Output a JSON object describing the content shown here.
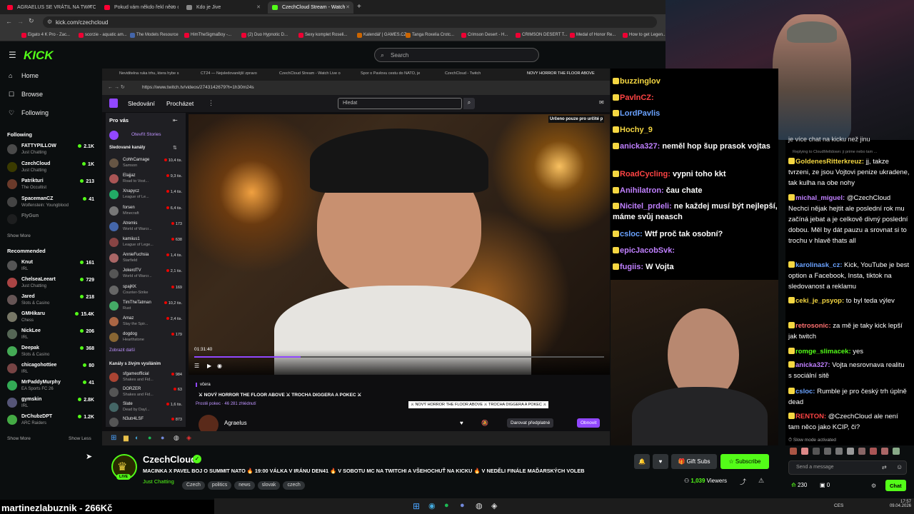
{
  "browser": {
    "tabs": [
      {
        "label": "AGRAELUS SE VRÁTIL NA TWITCH",
        "color": "#ff0033",
        "active": false
      },
      {
        "label": "Pokud vám někdo řekl něco o",
        "color": "#ff0033",
        "active": false
      },
      {
        "label": "Kdo je Jive",
        "color": "#888888",
        "active": false
      },
      {
        "label": "CzechCloud Stream - Watch",
        "color": "#53fc18",
        "active": true
      }
    ],
    "url": "kick.com/czechcloud",
    "bookmarks": [
      {
        "label": "Eigato 4 K Pro - Zac...",
        "color": "#e03"
      },
      {
        "label": "scorzie - aquatic am...",
        "color": "#e03"
      },
      {
        "label": "The Models Resource",
        "color": "#46a"
      },
      {
        "label": "HimTheSigmaBoy -...",
        "color": "#e03"
      },
      {
        "label": "(2) Duo Hypnotic D...",
        "color": "#e03"
      },
      {
        "label": "Sexy komplet Roseli...",
        "color": "#e03"
      },
      {
        "label": "Kalendář | GAMES.CZ",
        "color": "#c60"
      },
      {
        "label": "Tanga Roxelia Crotc...",
        "color": "#c60"
      },
      {
        "label": "Crimson Desert - H...",
        "color": "#e03"
      },
      {
        "label": "CRIMSON DESERT T...",
        "color": "#e03"
      },
      {
        "label": "Medal of Honor Re...",
        "color": "#e03"
      },
      {
        "label": "How to get Legen...",
        "color": "#e03"
      }
    ]
  },
  "kick": {
    "logo": "KICK",
    "search_placeholder": "Search",
    "nav": [
      {
        "icon": "⌂",
        "label": "Home"
      },
      {
        "icon": "☐",
        "label": "Browse"
      },
      {
        "icon": "♡",
        "label": "Following"
      }
    ],
    "following_title": "Following",
    "following": [
      {
        "name": "FATTYPILLOW",
        "category": "Just Chatting",
        "viewers": "2.1K",
        "color": "#4a4a4a"
      },
      {
        "name": "CzechCloud",
        "category": "Just Chatting",
        "viewers": "1K",
        "color": "#3a3a00"
      },
      {
        "name": "Patrikturi",
        "category": "The Occultist",
        "viewers": "213",
        "color": "#6a3a2a"
      },
      {
        "name": "SpacemanCZ",
        "category": "Wolfenstein: Youngblood",
        "viewers": "41",
        "color": "#444"
      },
      {
        "name": "FlyGun",
        "category": "",
        "viewers": "",
        "color": "#333"
      }
    ],
    "show_more": "Show More",
    "recommended_title": "Recommended",
    "recommended": [
      {
        "name": "Knut",
        "category": "IRL",
        "viewers": "161",
        "color": "#555"
      },
      {
        "name": "ChelseaLeeart",
        "category": "Just Chatting",
        "viewers": "729",
        "color": "#a44"
      },
      {
        "name": "Jared",
        "category": "Slots & Casino",
        "viewers": "218",
        "color": "#655"
      },
      {
        "name": "GMHikaru",
        "category": "Chess",
        "viewers": "15.4K",
        "color": "#776"
      },
      {
        "name": "NickLee",
        "category": "IRL",
        "viewers": "206",
        "color": "#565"
      },
      {
        "name": "Deepak",
        "category": "Slots & Casino",
        "viewers": "368",
        "color": "#4a5"
      },
      {
        "name": "chicagohottiee",
        "category": "IRL",
        "viewers": "80",
        "color": "#744"
      },
      {
        "name": "MrPaddyMurphy",
        "category": "EA Sports FC 26",
        "viewers": "41",
        "color": "#3a5"
      },
      {
        "name": "gymskin",
        "category": "IRL",
        "viewers": "2.8K",
        "color": "#557"
      },
      {
        "name": "DrChubzDPT",
        "category": "ARC Raiders",
        "viewers": "1.2K",
        "color": "#4a4"
      }
    ],
    "show_more_2": "Show More",
    "show_less": "Show Less"
  },
  "inner_browser": {
    "tabs": [
      "Neviditelna ruka trhu, ktera hybe s",
      "CT24 — Nejsledovanější zpravo",
      "CzechCloud Stream - Watch Live o",
      "Spor o Pavlovu cestu do NATO, je",
      "CzechCloud - Twitch",
      "NOVÝ HORROR THE FLOOR ABOVE"
    ],
    "url": "https://www.twitch.tv/videos/2743142679?t=1h30m24s"
  },
  "twitch": {
    "nav_following": "Sledování",
    "nav_browse": "Procházet",
    "search_placeholder": "Hledat",
    "for_you": "Pro vás",
    "open_stories": "Otevřít Stories",
    "followed_channels": "Sledované kanály",
    "channels": [
      {
        "name": "CohhCarnage",
        "category": "Samson",
        "viewers": "10,4 tis.",
        "color": "#654"
      },
      {
        "name": "Elajjaz",
        "category": "Road to Vost...",
        "viewers": "9,3 tis.",
        "color": "#a55"
      },
      {
        "name": "Xnapycz",
        "category": "League of Le...",
        "viewers": "1,4 tis.",
        "color": "#2a6"
      },
      {
        "name": "forsen",
        "category": "Minecraft",
        "viewers": "6,4 tis.",
        "color": "#777"
      },
      {
        "name": "Atremis",
        "category": "World of Warcr...",
        "viewers": "173",
        "color": "#46a"
      },
      {
        "name": "kamiius1",
        "category": "League of Lege...",
        "viewers": "638",
        "color": "#844"
      },
      {
        "name": "AnnieFuchsia",
        "category": "Starfield",
        "viewers": "1,4 tis.",
        "color": "#a66"
      },
      {
        "name": "JokerdTV",
        "category": "World of Warcr...",
        "viewers": "2,1 tis.",
        "color": "#555"
      },
      {
        "name": "spajKK",
        "category": "Counter-Strike",
        "viewers": "169",
        "color": "#666"
      },
      {
        "name": "TimTheTatman",
        "category": "Rust",
        "viewers": "10,2 tis.",
        "color": "#4a6"
      },
      {
        "name": "Amaz",
        "category": "Slay the Spir...",
        "viewers": "2,4 tis.",
        "color": "#a64"
      },
      {
        "name": "dogdog",
        "category": "Hearthstone",
        "viewers": "179",
        "color": "#863"
      }
    ],
    "show_more": "Zobrazit další",
    "live_title": "Kanály s živým vysíláním",
    "live_channels": [
      {
        "name": "sfgameofficial",
        "category": "Shakes and Fid...",
        "viewers": "984",
        "color": "#a43"
      },
      {
        "name": "DORZER",
        "category": "Shakes and Fid...",
        "viewers": "63",
        "color": "#555"
      },
      {
        "name": "Slate",
        "category": "Dead by Dayl...",
        "viewers": "1,6 tis.",
        "color": "#466"
      },
      {
        "name": "N3utr4LSF",
        "category": "",
        "viewers": "873",
        "color": "#555"
      }
    ],
    "only_for": "Určeno pouze pro určité p",
    "timestamp": "01:31:40",
    "video_day": "včera",
    "video_title": "⚔ NOVÝ HORROR THE FLOOR ABOVE ⚔ TROCHA DIGGERA A POKEC ⚔",
    "tooltip": "⚔ NOVÝ HORROR THE FLOOR ABOVE ⚔ TROCHA DIGGERA A POKEC ⚔",
    "video_meta": "Prostě pokec · 46 281 zhlédnutí",
    "streamer": "Agraelus",
    "subscribe_gift": "Darovat předplatné",
    "renew": "Obnovit"
  },
  "channel": {
    "name": "CzechCloud",
    "live": "LIVE",
    "title": "MACINKA X PAVEL BOJ O SUMMIT NATO 🔥 19:00 VÁLKA V IRÁNU DEN41 🔥 V SOBOTU MC NA TWITCHI A VŠEHOCHUŤ NA KICKU 🔥 V NEDĚLI FINÁLE MAĎARSKÝCH VOLEB",
    "category": "Just Chatting",
    "tags": [
      "Czech",
      "politics",
      "news",
      "slovak",
      "czech"
    ],
    "gift_subs": "Gift Subs",
    "subscribe": "Subscribe",
    "viewers": "1,039",
    "viewers_label": "Viewers"
  },
  "overlay_name": "martinezlabuznik - 266Kč",
  "chat_left": [
    {
      "user": "buzzinglov",
      "color": "#f5d742",
      "msg": ""
    },
    {
      "user": "PavlnCZ:",
      "color": "#ff4444",
      "msg": ""
    },
    {
      "user": "LordPavlis",
      "color": "#6aa2ff",
      "msg": ""
    },
    {
      "user": "Hochy_9",
      "color": "#f5d742",
      "msg": ""
    },
    {
      "user": "anicka327:",
      "color": "#c080ff",
      "msg": "neměl hop šup prasok vojtas"
    },
    {
      "user": "RoadCycling:",
      "color": "#ff4444",
      "msg": "vypni toho kkt"
    },
    {
      "user": "Anihilatron:",
      "color": "#c080ff",
      "msg": "čau chate"
    },
    {
      "user": "Nicitel_prdeli:",
      "color": "#c080ff",
      "msg": "ne každej musí být nejlepší, máme svůj neasch"
    },
    {
      "user": "csloc:",
      "color": "#6aa2ff",
      "msg": "Wtf proč tak osobní?"
    },
    {
      "user": "epicJacobSvk:",
      "color": "#c080ff",
      "msg": ""
    },
    {
      "user": "fugiis:",
      "color": "#c080ff",
      "msg": "W Vojta"
    }
  ],
  "chat_right": {
    "top_text": "je více chat na kicku než jinu",
    "reply_note": "Replying to CloudMeltdown: ji prime nebo tam ...",
    "messages": [
      {
        "user": "GoldenesRitterkreuz:",
        "color": "#f5d742",
        "msg": "jj, takze tvrzeni, ze jsou Vojtovi penize ukradene, tak kulha na obe nohy"
      },
      {
        "user": "michal_miguel:",
        "color": "#c080ff",
        "msg": "@CzechCloud Nechci nějak hejtit ale poslední rok mu začíná jebat a je celkově divný poslední dobou. Měl by dát pauzu a srovnat si to trochu v hlavě thats all"
      },
      {
        "user": "karolinask_cz:",
        "color": "#6aa2ff",
        "msg": "Kick, YouTube je best option a Facebook, Insta, tiktok na sledovanost a reklamu"
      },
      {
        "user": "ceki_je_psyop:",
        "color": "#f5d742",
        "msg": "to byl teda výlev"
      },
      {
        "user": "retrosonic:",
        "color": "#ff7070",
        "msg": "za mě je taky kick lepší jak twitch"
      },
      {
        "user": "romge_slimacek:",
        "color": "#53fc18",
        "msg": "yes"
      },
      {
        "user": "anicka327:",
        "color": "#c080ff",
        "msg": "Vojta nesrovnava realitu s sociální sitě"
      },
      {
        "user": "csloc:",
        "color": "#6aa2ff",
        "msg": "Rumble je pro český trh úplně dead"
      },
      {
        "user": "RENTON:",
        "color": "#ff4444",
        "msg": "@CzechCloud ale není tam něco jako KCIP, či?"
      }
    ],
    "slow_mode": "Slow mode activated",
    "input_placeholder": "Send a message",
    "points": "230",
    "count": "0",
    "chat_button": "Chat"
  },
  "taskbar": {
    "lang": "CES",
    "time": "17:57",
    "date": "09.04.2026"
  }
}
